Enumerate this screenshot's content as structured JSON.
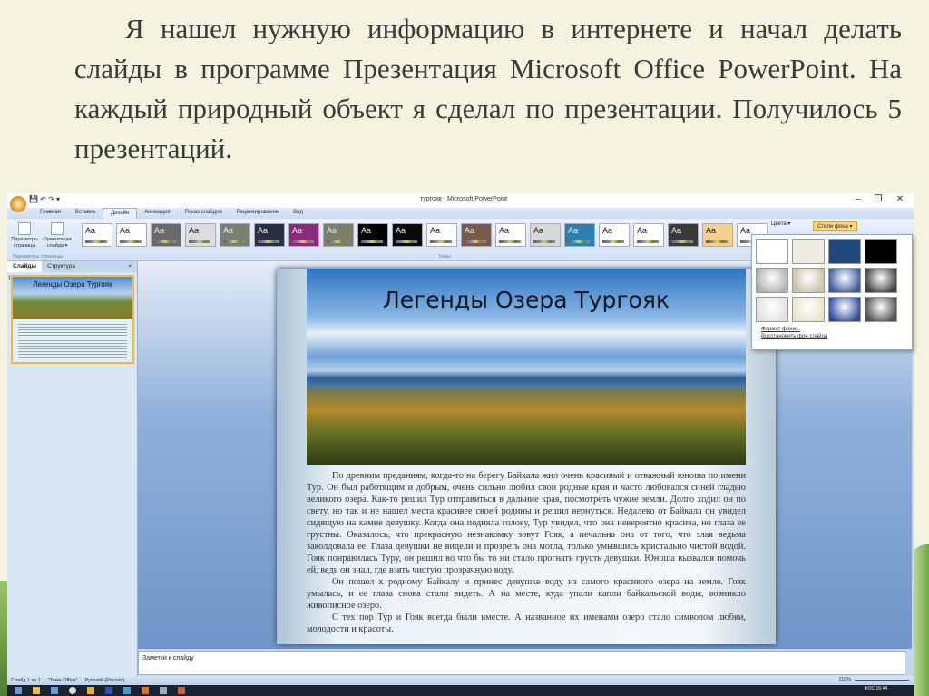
{
  "heading": "Я нашел нужную информацию в интернете и начал делать слайды в программе Презентация Microsoft Office PowerPoint. На каждый природный объект я  сделал по презентации. Получилось 5 презентаций.",
  "window": {
    "title": "тургояк - Microsoft PowerPoint",
    "minimize": "–",
    "maximize": "❐",
    "close": "✕"
  },
  "tabs": [
    "Главная",
    "Вставка",
    "Дизайн",
    "Анимация",
    "Показ слайдов",
    "Рецензирование",
    "Вид"
  ],
  "ribbon": {
    "page_setup": "Параметры страницы",
    "orientation": "Ориентация слайда ▾",
    "group_page": "Параметры страницы",
    "group_themes": "Темы",
    "colors": "Цвета ▾",
    "bg_styles": "Стили фона ▾",
    "theme_sample": "Aa"
  },
  "theme_colors": [
    "#ffffff",
    "#ffffff",
    "#6a6a6a",
    "#dcdcdc",
    "#7a8070",
    "#2a2f45",
    "#8a2a7a",
    "#7c8068",
    "#000000",
    "#0a0a0a",
    "#ffffff",
    "#7a5a4a",
    "#ffffff",
    "#d8d8d8",
    "#2a80b0",
    "#ffffff",
    "#ffffff",
    "#3a3a3a",
    "#f4d08a",
    "#ffffff"
  ],
  "left_pane": {
    "tabs": [
      "Слайды",
      "Структура"
    ],
    "close": "×",
    "slide_number": "1",
    "thumb_title": "Легенды Озера Тургояк"
  },
  "slide": {
    "title": "Легенды Озера Тургояк",
    "paragraphs": [
      "По древним преданиям, когда-то на берегу Байкала жил очень красивый и отважный юноша по имени Тур. Он был работящим и добрым, очень сильно любил свои родные края и часто любовался синей гладью великого озера. Как-то решил Тур отправиться в дальние края, посмотреть чужие земли. Долго ходил он по свету, но так и не нашел места красивее своей родины и решил вернуться. Недалеко от Байкала он увидел сидящую на камне девушку. Когда она подняла голову, Тур увидел, что она невероятно красива, но глаза ее грустны. Оказалось, что прекрасную незнакомку зовут Гояк, а печальна она от того, что злая ведьма заколдовала ее. Глаза девушки не видели и прозреть она могла, только умывшись кристально чистой водой. Гояк понравилась Туру, он решил во что бы то ни стало прогнать грусть девушки. Юноша вызвался помочь ей, ведь он знал, где взять чистую прозрачную воду.",
      "Он пошел к родному Байкалу и принес  девушке воду из самого красивого озера на земле. Гояк умылась, и ее глаза снова стали видеть. А на месте, куда упали капли байкальской воды, возникло живописное озеро.",
      "С тех пор Тур и Гояк всегда были вместе.  А названное их именами озеро стало символом любви, молодости и красоты."
    ]
  },
  "dropdown": {
    "swatches": [
      "#ffffff",
      "#eeece1",
      "#1f497d",
      "#000000",
      "#b0b0b0",
      "#c8c2a8",
      "#3a5a9a",
      "#404040",
      "#e0e0e0",
      "#e8e4c8",
      "#2a4a9a",
      "#505050"
    ],
    "format_bg": "Формат фона...",
    "reset_bg": "Восстановить фон слайда"
  },
  "notes_placeholder": "Заметки к слайду",
  "status": {
    "slide": "Слайд 1 из 1",
    "theme": "\"Тема Office\"",
    "lang": "Русский (Россия)",
    "zoom": "110%"
  },
  "taskbar": {
    "time": "16:44",
    "lang": "ФОС"
  }
}
